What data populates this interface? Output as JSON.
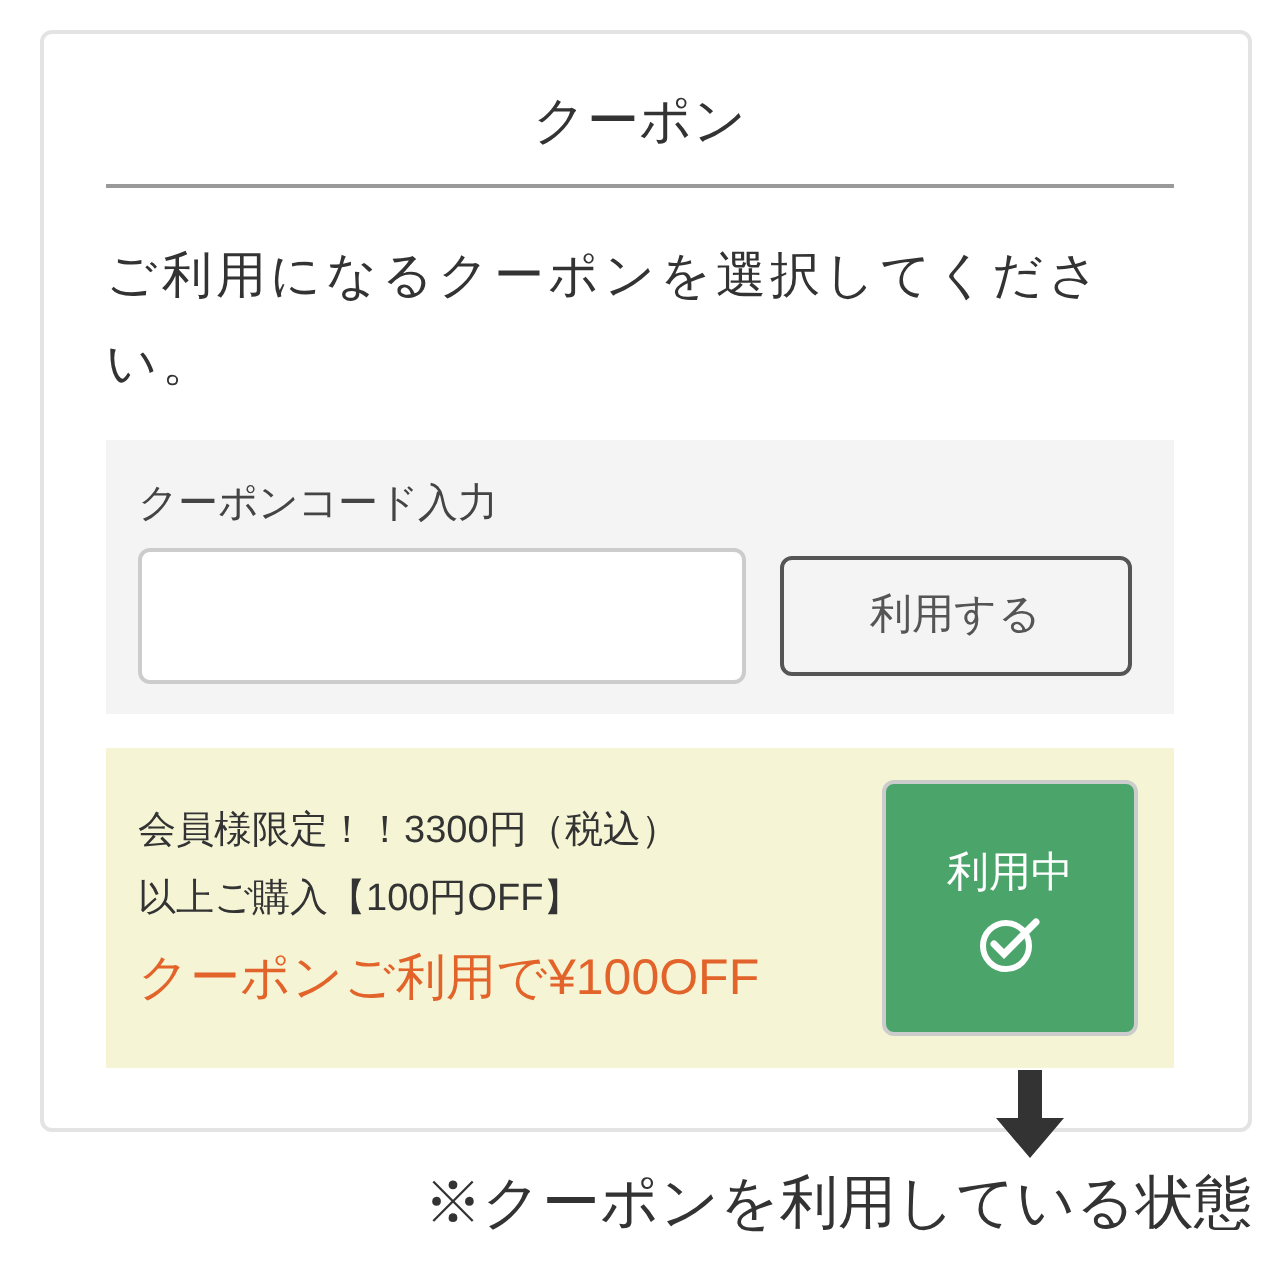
{
  "title": "クーポン",
  "instruction": "ご利用になるクーポンを選択してください。",
  "code_entry": {
    "label": "クーポンコード入力",
    "button": "利用する"
  },
  "coupons": [
    {
      "lines": [
        "会員様限定！！3300円（税込）",
        "以上ご購入【100円OFF】"
      ],
      "discount": "クーポンご利用で¥100OFF",
      "button": "利用中",
      "applied": true
    }
  ],
  "note": "※クーポンを利用している状態"
}
